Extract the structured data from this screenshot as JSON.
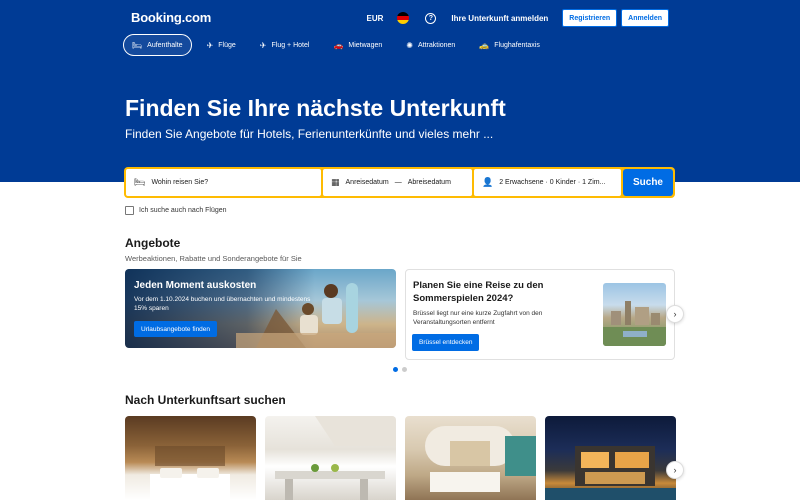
{
  "header": {
    "logo": "Booking.com",
    "currency": "EUR",
    "help_icon": "?",
    "list_property": "Ihre Unterkunft anmelden",
    "register_label": "Registrieren",
    "login_label": "Anmelden"
  },
  "nav": {
    "items": [
      {
        "label": "Aufenthalte",
        "icon": "bed-icon",
        "glyph": "🛏",
        "active": true
      },
      {
        "label": "Flüge",
        "icon": "plane-icon",
        "glyph": "✈",
        "active": false
      },
      {
        "label": "Flug + Hotel",
        "icon": "plane-hotel-icon",
        "glyph": "✈",
        "active": false
      },
      {
        "label": "Mietwagen",
        "icon": "car-icon",
        "glyph": "🚗",
        "active": false
      },
      {
        "label": "Attraktionen",
        "icon": "attractions-icon",
        "glyph": "✺",
        "active": false
      },
      {
        "label": "Flughafentaxis",
        "icon": "taxi-icon",
        "glyph": "🚕",
        "active": false
      }
    ]
  },
  "hero": {
    "title": "Finden Sie Ihre nächste Unterkunft",
    "subtitle": "Finden Sie Angebote für Hotels, Ferienunterkünfte und vieles mehr ..."
  },
  "search": {
    "destination_placeholder": "Wohin reisen Sie?",
    "checkin": "Anreisedatum",
    "dash": "—",
    "checkout": "Abreisedatum",
    "guests": "2 Erwachsene · 0 Kinder · 1 Zim...",
    "submit_label": "Suche"
  },
  "flights_checkbox": "Ich suche auch nach Flügen",
  "offers": {
    "title": "Angebote",
    "subtitle": "Werbeaktionen, Rabatte und Sonderangebote für Sie",
    "card1": {
      "title": "Jeden Moment auskosten",
      "text": "Vor dem 1.10.2024 buchen und übernachten und mindestens 15% sparen",
      "button": "Urlaubsangebote finden"
    },
    "card2": {
      "title": "Planen Sie eine Reise zu den Sommerspielen 2024?",
      "text": "Brüssel liegt nur eine kurze Zugfahrt von den Veranstaltungsorten entfernt",
      "button": "Brüssel entdecken"
    },
    "next_arrow": "›"
  },
  "property_types": {
    "title": "Nach Unterkunftsart suchen",
    "next_arrow": "›"
  },
  "colors": {
    "brand_blue": "#003b95",
    "action_blue": "#006ce4",
    "search_yellow": "#febb02"
  }
}
